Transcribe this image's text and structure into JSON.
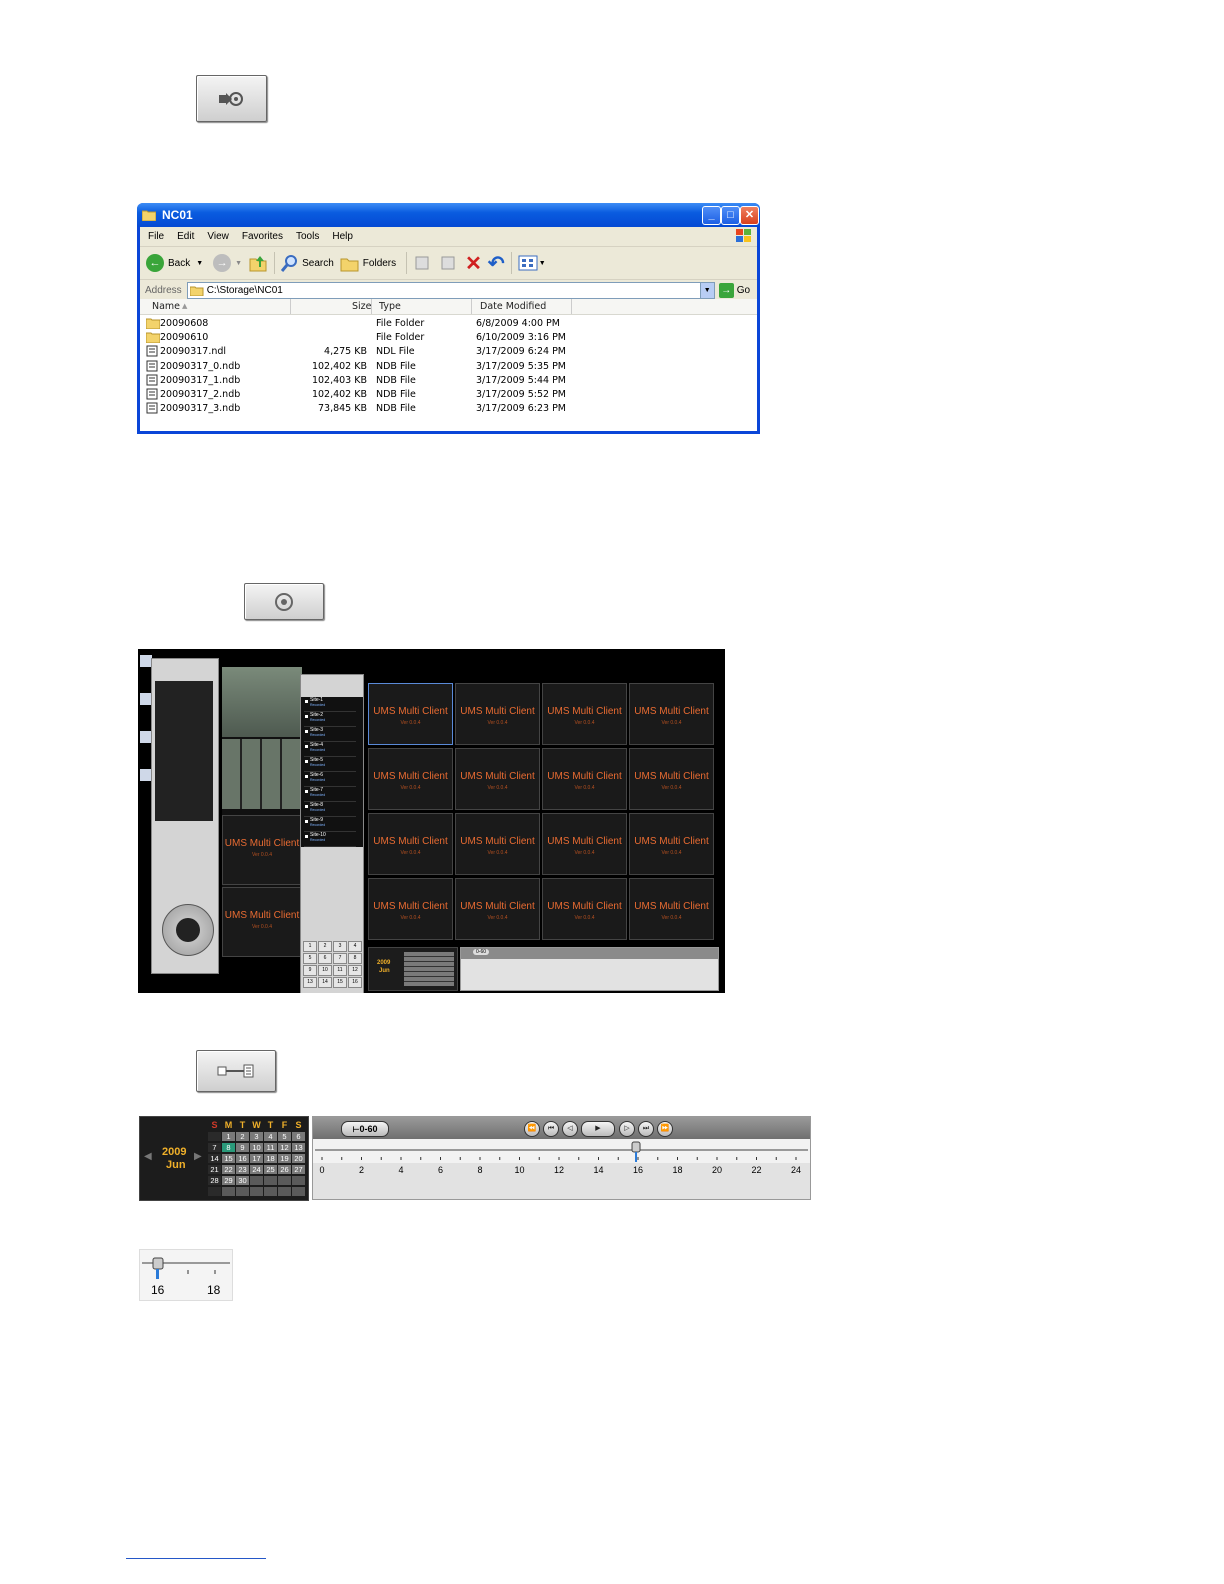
{
  "explorer": {
    "title": "NC01",
    "menu": [
      "File",
      "Edit",
      "View",
      "Favorites",
      "Tools",
      "Help"
    ],
    "toolbar": {
      "back": "Back",
      "search": "Search",
      "folders": "Folders"
    },
    "address_label": "Address",
    "address_value": "C:\\Storage\\NC01",
    "go": "Go",
    "columns": {
      "name": "Name",
      "size": "Size",
      "type": "Type",
      "date": "Date Modified"
    },
    "files": [
      {
        "name": "20090608",
        "size": "",
        "type": "File Folder",
        "date": "6/8/2009 4:00 PM",
        "icon": "folder-icon"
      },
      {
        "name": "20090610",
        "size": "",
        "type": "File Folder",
        "date": "6/10/2009 3:16 PM",
        "icon": "folder-icon"
      },
      {
        "name": "20090317.ndl",
        "size": "4,275 KB",
        "type": "NDL File",
        "date": "3/17/2009 6:24 PM",
        "icon": "file-icon"
      },
      {
        "name": "20090317_0.ndb",
        "size": "102,402 KB",
        "type": "NDB File",
        "date": "3/17/2009 5:35 PM",
        "icon": "file-icon"
      },
      {
        "name": "20090317_1.ndb",
        "size": "102,403 KB",
        "type": "NDB File",
        "date": "3/17/2009 5:44 PM",
        "icon": "file-icon"
      },
      {
        "name": "20090317_2.ndb",
        "size": "102,402 KB",
        "type": "NDB File",
        "date": "3/17/2009 5:52 PM",
        "icon": "file-icon"
      },
      {
        "name": "20090317_3.ndb",
        "size": "73,845 KB",
        "type": "NDB File",
        "date": "3/17/2009 6:23 PM",
        "icon": "file-icon"
      }
    ]
  },
  "dvr": {
    "cell_title": "UMS Multi Client",
    "cell_version": "Ver 0.0.4",
    "sites": [
      {
        "name": "Site-1",
        "status": "Recorded"
      },
      {
        "name": "Site-2",
        "status": "Recorded"
      },
      {
        "name": "Site-3",
        "status": "Recorded"
      },
      {
        "name": "Site-4",
        "status": "Recorded"
      },
      {
        "name": "Site-5",
        "status": "Recorded"
      },
      {
        "name": "Site-6",
        "status": "Recorded"
      },
      {
        "name": "Site-7",
        "status": "Recorded"
      },
      {
        "name": "Site-8",
        "status": "Recorded"
      },
      {
        "name": "Site-9",
        "status": "Recorded"
      },
      {
        "name": "Site-10",
        "status": "Recorded"
      }
    ],
    "keypad": [
      "1",
      "2",
      "3",
      "4",
      "5",
      "6",
      "7",
      "8",
      "9",
      "10",
      "11",
      "12",
      "13",
      "14",
      "15",
      "16"
    ],
    "mini_year": "2009",
    "mini_month": "Jun",
    "mini_range": "0-60"
  },
  "timeline": {
    "year": "2009",
    "month": "Jun",
    "weekdays": [
      "S",
      "M",
      "T",
      "W",
      "T",
      "F",
      "S"
    ],
    "weeks": [
      [
        "",
        "1",
        "2",
        "3",
        "4",
        "5",
        "6"
      ],
      [
        "7",
        "8",
        "9",
        "10",
        "11",
        "12",
        "13"
      ],
      [
        "14",
        "15",
        "16",
        "17",
        "18",
        "19",
        "20"
      ],
      [
        "21",
        "22",
        "23",
        "24",
        "25",
        "26",
        "27"
      ],
      [
        "28",
        "29",
        "30",
        "",
        "",
        "",
        ""
      ],
      [
        "",
        "",
        "",
        "",
        "",
        "",
        ""
      ]
    ],
    "selected_day": "8",
    "range_label": "0-60",
    "hour_labels": [
      "0",
      "2",
      "4",
      "6",
      "8",
      "10",
      "12",
      "14",
      "16",
      "18",
      "20",
      "22",
      "24"
    ],
    "current_hour": 15.9
  },
  "zoom": {
    "labels": [
      "16",
      "18"
    ]
  },
  "colors": {
    "xp_blue": "#0a46d8",
    "cell_text": "#e86b32",
    "weekday_gold": "#f0b02a",
    "sunday_red": "#d23a2a",
    "selected_day": "#2a9a7a"
  }
}
